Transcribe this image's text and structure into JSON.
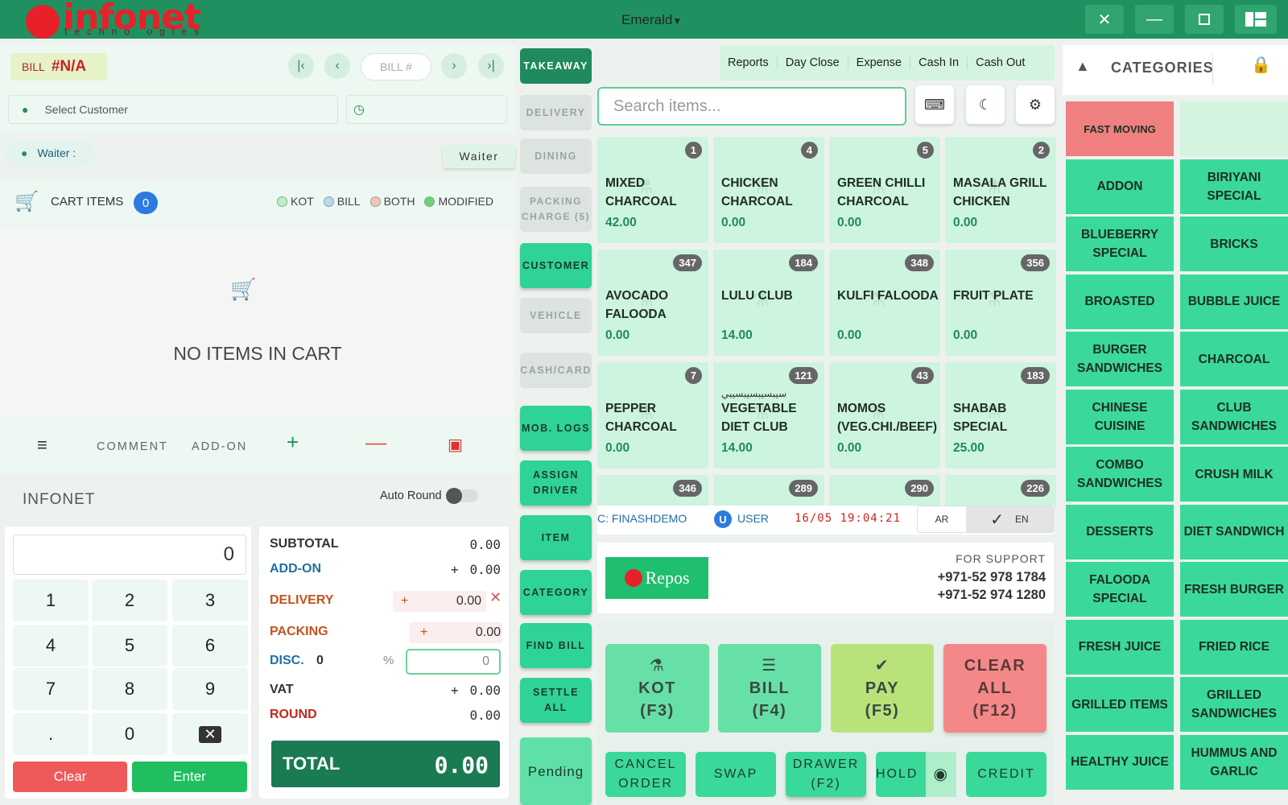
{
  "window": {
    "name": "Emerald",
    "dropdown_icon": "caret-down-icon"
  },
  "brand": {
    "logo_text": "infonet",
    "logo_sub": "techno ogies"
  },
  "bill": {
    "label": "BILL",
    "number": "#N/A",
    "bill_placeholder": "BILL #"
  },
  "customer": {
    "placeholder": "Select Customer"
  },
  "waiter": {
    "label": "Waiter :",
    "button": "Waiter"
  },
  "cart": {
    "title": "CART ITEMS",
    "count": "0",
    "empty": "NO ITEMS IN CART",
    "legend": [
      {
        "label": "KOT",
        "color": "#b9f0c9"
      },
      {
        "label": "BILL",
        "color": "#bcd4f6"
      },
      {
        "label": "BOTH",
        "color": "#f6c1bf"
      },
      {
        "label": "MODIFIED",
        "color": "#6fcf7a"
      }
    ],
    "comment": "COMMENT",
    "addon": "ADD-ON"
  },
  "company": "INFONET",
  "auto_round": "Auto Round",
  "keypad": {
    "display": "0",
    "keys": [
      "1",
      "2",
      "3",
      "4",
      "5",
      "6",
      "7",
      "8",
      "9",
      ".",
      "0"
    ],
    "clear": "Clear",
    "enter": "Enter"
  },
  "summary": {
    "subtotal_label": "SUBTOTAL",
    "subtotal": "0.00",
    "addon_label": "ADD-ON",
    "addon": "0.00",
    "delivery_label": "DELIVERY",
    "delivery": "0.00",
    "packing_label": "PACKING",
    "packing": "0.00",
    "disc_label": "DISC.",
    "disc_value": "0",
    "disc_pct": "%",
    "disc_input": "0",
    "vat_label": "VAT",
    "vat": "0.00",
    "round_label": "ROUND",
    "round": "0.00",
    "total_label": "TOTAL",
    "total": "0.00",
    "plus": "+"
  },
  "modes": [
    "TAKEAWAY",
    "DELIVERY",
    "DINING",
    "PACKING CHARGE (5)",
    "CUSTOMER",
    "VEHICLE",
    "CASH/CARD",
    "MOB. LOGS",
    "ASSIGN DRIVER",
    "ITEM",
    "CATEGORY",
    "FIND BILL",
    "SETTLE ALL",
    "Pending"
  ],
  "topnav": [
    "Reports",
    "Day Close",
    "Expense",
    "Cash In",
    "Cash Out"
  ],
  "search": {
    "placeholder": "Search items..."
  },
  "items": [
    {
      "badge": "1",
      "name": "MIXED CHARCOAL",
      "price": "42.00"
    },
    {
      "badge": "4",
      "name": "CHICKEN CHARCOAL",
      "price": "0.00"
    },
    {
      "badge": "5",
      "name": "GREEN CHILLI CHARCOAL",
      "price": "0.00"
    },
    {
      "badge": "2",
      "name": "MASALA GRILL CHICKEN",
      "price": "0.00"
    },
    {
      "badge": "347",
      "name": "AVOCADO FALOODA",
      "price": "0.00"
    },
    {
      "badge": "184",
      "name": "LULU CLUB",
      "price": "14.00"
    },
    {
      "badge": "348",
      "name": "KULFI FALOODA",
      "price": "0.00"
    },
    {
      "badge": "356",
      "name": "FRUIT PLATE",
      "price": "0.00"
    },
    {
      "badge": "7",
      "name": "PEPPER CHARCOAL",
      "price": "0.00"
    },
    {
      "badge": "121",
      "name": "VEGETABLE DIET CLUB",
      "price": "14.00",
      "arabic": "سيبسيبسيبسيبي"
    },
    {
      "badge": "43",
      "name": "MOMOS (VEG.CHI./BEEF)",
      "price": "0.00"
    },
    {
      "badge": "183",
      "name": "SHABAB SPECIAL",
      "price": "25.00"
    }
  ],
  "items_partial": [
    "346",
    "289",
    "290",
    "226"
  ],
  "status": {
    "company": "C: FINASHDEMO",
    "user_initial": "U",
    "user": "USER",
    "datetime": "16/05 19:04:21",
    "lang_ar": "AR",
    "lang_en": "EN"
  },
  "support": {
    "title": "FOR SUPPORT",
    "phone1": "+971-52 978 1784",
    "phone2": "+971-52 974 1280",
    "repos": "Repos"
  },
  "actions": {
    "kot": "KOT",
    "kot_key": "(F3)",
    "bill": "BILL",
    "bill_key": "(F4)",
    "pay": "PAY",
    "pay_key": "(F5)",
    "clear": "CLEAR ALL",
    "clear_key": "(F12)",
    "cancel": "CANCEL ORDER",
    "swap": "SWAP",
    "drawer": "DRAWER (F2)",
    "hold": "HOLD",
    "credit": "CREDIT"
  },
  "categories": {
    "title": "CATEGORIES",
    "list": [
      "FAST MOVING",
      "",
      "ADDON",
      "BIRIYANI SPECIAL",
      "BLUEBERRY SPECIAL",
      "BRICKS",
      "BROASTED",
      "BUBBLE JUICE",
      "BURGER SANDWICHES",
      "CHARCOAL",
      "CHINESE CUISINE",
      "CLUB SANDWICHES",
      "COMBO SANDWICHES",
      "CRUSH MILK",
      "DESSERTS",
      "DIET SANDWICH",
      "FALOODA SPECIAL",
      "FRESH BURGER",
      "FRESH JUICE",
      "FRIED RICE",
      "GRILLED ITEMS",
      "GRILLED SANDWICHES",
      "HEALTHY JUICE",
      "HUMMUS AND GARLIC"
    ]
  },
  "colors": {
    "primary": "#1f9161",
    "accent": "#3ad99a",
    "danger": "#e55353",
    "fast_moving": "#f08080"
  }
}
